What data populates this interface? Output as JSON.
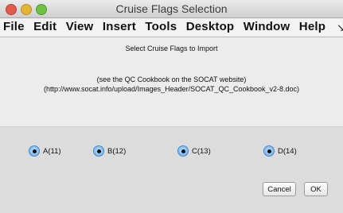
{
  "window": {
    "title": "Cruise Flags Selection"
  },
  "menubar": {
    "items": [
      "File",
      "Edit",
      "View",
      "Insert",
      "Tools",
      "Desktop",
      "Window",
      "Help"
    ],
    "overflow_glyph": "↘"
  },
  "dialog": {
    "heading": "Select Cruise Flags to Import",
    "hint_line1": "(see the QC Cookbook on the SOCAT website)",
    "hint_line2": "(http://www.socat.info/upload/Images_Header/SOCAT_QC_Cookbook_v2-8.doc)",
    "options": [
      {
        "label": "A(11)",
        "selected": true
      },
      {
        "label": "B(12)",
        "selected": true
      },
      {
        "label": "C(13)",
        "selected": true
      },
      {
        "label": "D(14)",
        "selected": true
      }
    ],
    "cancel_label": "Cancel",
    "ok_label": "OK"
  }
}
